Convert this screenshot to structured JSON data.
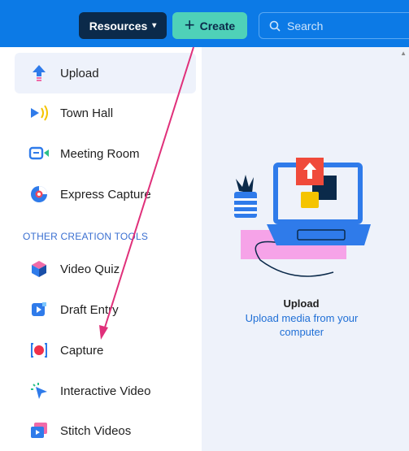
{
  "topbar": {
    "resources_label": "Resources",
    "create_label": "Create",
    "search_placeholder": "Search"
  },
  "sidebar": {
    "items": [
      {
        "label": "Upload",
        "icon": "upload-arrow-icon"
      },
      {
        "label": "Town Hall",
        "icon": "broadcast-icon"
      },
      {
        "label": "Meeting Room",
        "icon": "meeting-room-icon"
      },
      {
        "label": "Express Capture",
        "icon": "express-capture-icon"
      }
    ],
    "section_label": "OTHER CREATION TOOLS",
    "tools": [
      {
        "label": "Video Quiz",
        "icon": "cube-icon"
      },
      {
        "label": "Draft Entry",
        "icon": "draft-entry-icon"
      },
      {
        "label": "Capture",
        "icon": "record-icon"
      },
      {
        "label": "Interactive Video",
        "icon": "interactive-cursor-icon"
      },
      {
        "label": "Stitch Videos",
        "icon": "stitch-videos-icon"
      }
    ]
  },
  "main": {
    "title": "Upload",
    "description": "Upload media from your computer"
  },
  "colors": {
    "topbar": "#0c7ae6",
    "resources_bg": "#0b2a4a",
    "create_bg": "#4fd1b8",
    "annotation_arrow": "#e0307a"
  }
}
